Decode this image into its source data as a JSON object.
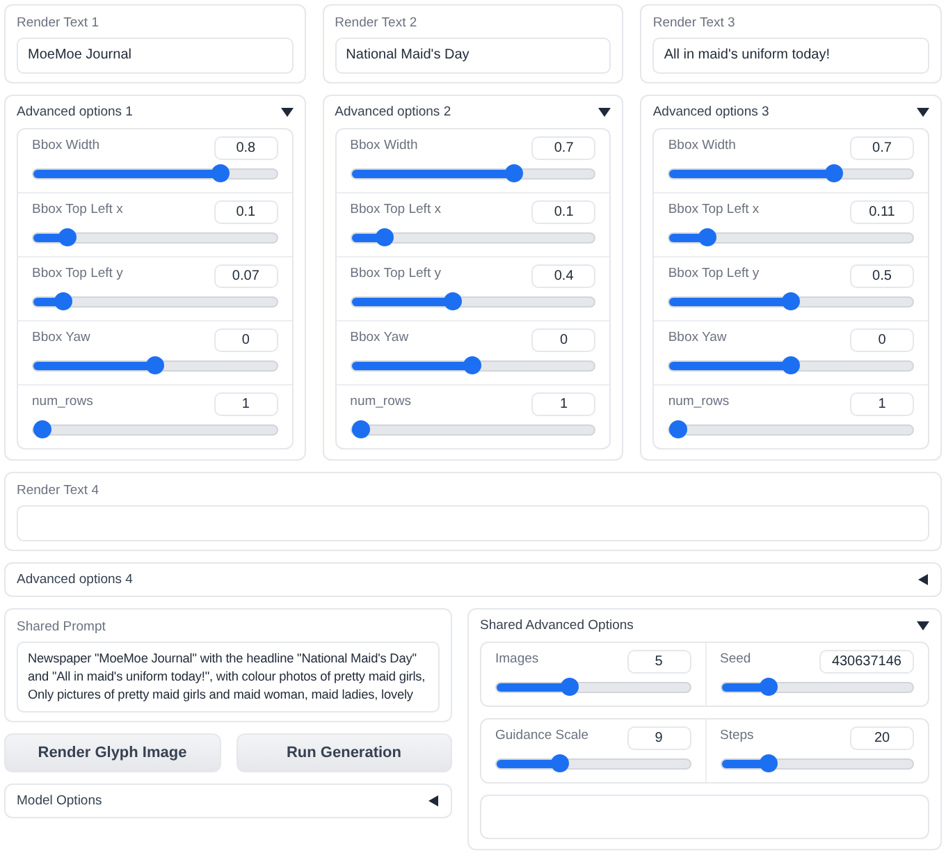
{
  "render_texts": [
    {
      "label": "Render Text 1",
      "value": "MoeMoe Journal"
    },
    {
      "label": "Render Text 2",
      "value": "National Maid's Day"
    },
    {
      "label": "Render Text 3",
      "value": "All in maid's uniform today!"
    }
  ],
  "advanced_options": [
    {
      "title": "Advanced options 1",
      "expanded": true,
      "sliders": [
        {
          "label": "Bbox Width",
          "value": "0.8",
          "level": 0.79
        },
        {
          "label": "Bbox Top Left x",
          "value": "0.1",
          "level": 0.11
        },
        {
          "label": "Bbox Top Left y",
          "value": "0.07",
          "level": 0.09
        },
        {
          "label": "Bbox Yaw",
          "value": "0",
          "level": 0.5
        },
        {
          "label": "num_rows",
          "value": "1",
          "level": 0
        }
      ]
    },
    {
      "title": "Advanced options 2",
      "expanded": true,
      "sliders": [
        {
          "label": "Bbox Width",
          "value": "0.7",
          "level": 0.68
        },
        {
          "label": "Bbox Top Left x",
          "value": "0.1",
          "level": 0.11
        },
        {
          "label": "Bbox Top Left y",
          "value": "0.4",
          "level": 0.41
        },
        {
          "label": "Bbox Yaw",
          "value": "0",
          "level": 0.5
        },
        {
          "label": "num_rows",
          "value": "1",
          "level": 0
        }
      ]
    },
    {
      "title": "Advanced options 3",
      "expanded": true,
      "sliders": [
        {
          "label": "Bbox Width",
          "value": "0.7",
          "level": 0.69
        },
        {
          "label": "Bbox Top Left x",
          "value": "0.11",
          "level": 0.13
        },
        {
          "label": "Bbox Top Left y",
          "value": "0.5",
          "level": 0.5
        },
        {
          "label": "Bbox Yaw",
          "value": "0",
          "level": 0.5
        },
        {
          "label": "num_rows",
          "value": "1",
          "level": 0
        }
      ]
    }
  ],
  "render_text_4": {
    "label": "Render Text 4"
  },
  "advanced_options_4": {
    "title": "Advanced options 4",
    "expanded": false
  },
  "shared_prompt": {
    "label": "Shared Prompt",
    "value": "Newspaper \"MoeMoe Journal\" with the headline \"National Maid's Day\" and \"All in maid's uniform today!\", with colour photos of pretty maid girls, Only pictures of pretty maid girls and maid woman, maid ladies, lovely"
  },
  "buttons": [
    "Render Glyph Image",
    "Run Generation"
  ],
  "model_options": {
    "title": "Model Options",
    "expanded": false
  },
  "shared_advanced_options": {
    "title": "Shared Advanced Options",
    "expanded": true,
    "rows": [
      {
        "sliders": [
          {
            "label": "Images",
            "value": "5",
            "level": 0.37
          },
          {
            "label": "Seed",
            "value": "430637146",
            "level": 0.22
          }
        ]
      },
      {
        "sliders": [
          {
            "label": "Guidance Scale",
            "value": "9",
            "level": 0.31
          },
          {
            "label": "Steps",
            "value": "20",
            "level": 0.22
          }
        ]
      }
    ]
  }
}
